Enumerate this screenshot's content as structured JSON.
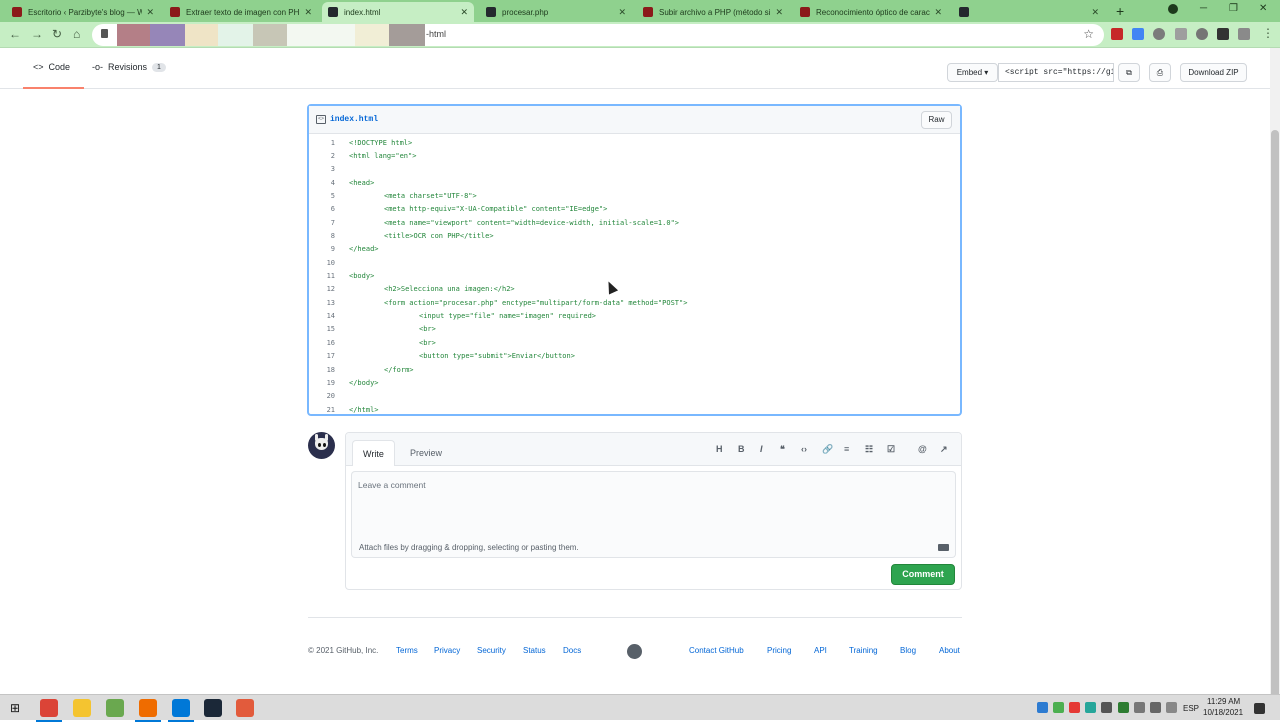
{
  "browser": {
    "tabs": [
      {
        "title": "Escritorio ‹ Parzibyte's blog — W",
        "icon_color": "#8b1a1a"
      },
      {
        "title": "Extraer texto de imagen con PHP",
        "icon_color": "#8b1a1a"
      },
      {
        "title": "index.html",
        "icon_color": "#24292e"
      },
      {
        "title": "procesar.php",
        "icon_color": "#24292e"
      },
      {
        "title": "Subir archivo a PHP (método sin",
        "icon_color": "#8b1a1a"
      },
      {
        "title": "Reconocimiento óptico de carac",
        "icon_color": "#8b1a1a"
      },
      {
        "title": "",
        "icon_color": "#24292e"
      }
    ],
    "new_tab": "+",
    "url_suffix": "-html"
  },
  "gist_nav": {
    "code_label": "Code",
    "revisions_label": "Revisions",
    "revisions_count": "1",
    "embed_label": "Embed",
    "embed_value": "<script src=\"https://gis",
    "download_label": "Download ZIP"
  },
  "file": {
    "name": "index.html",
    "raw_label": "Raw",
    "lines": [
      {
        "n": "1",
        "text": "<!DOCTYPE html>",
        "indent": 0
      },
      {
        "n": "2",
        "text": "<html lang=\"en\">",
        "indent": 0
      },
      {
        "n": "3",
        "text": "",
        "indent": 0
      },
      {
        "n": "4",
        "text": "<head>",
        "indent": 0
      },
      {
        "n": "5",
        "text": "<meta charset=\"UTF-8\">",
        "indent": 1
      },
      {
        "n": "6",
        "text": "<meta http-equiv=\"X-UA-Compatible\" content=\"IE=edge\">",
        "indent": 1
      },
      {
        "n": "7",
        "text": "<meta name=\"viewport\" content=\"width=device-width, initial-scale=1.0\">",
        "indent": 1
      },
      {
        "n": "8",
        "text": "<title>OCR con PHP</title>",
        "indent": 1
      },
      {
        "n": "9",
        "text": "</head>",
        "indent": 0
      },
      {
        "n": "10",
        "text": "",
        "indent": 0
      },
      {
        "n": "11",
        "text": "<body>",
        "indent": 0
      },
      {
        "n": "12",
        "text": "<h2>Selecciona una imagen:</h2>",
        "indent": 1
      },
      {
        "n": "13",
        "text": "<form action=\"procesar.php\" enctype=\"multipart/form-data\" method=\"POST\">",
        "indent": 1
      },
      {
        "n": "14",
        "text": "<input type=\"file\" name=\"imagen\" required>",
        "indent": 2
      },
      {
        "n": "15",
        "text": "<br>",
        "indent": 2
      },
      {
        "n": "16",
        "text": "<br>",
        "indent": 2
      },
      {
        "n": "17",
        "text": "<button type=\"submit\">Enviar</button>",
        "indent": 2
      },
      {
        "n": "18",
        "text": "</form>",
        "indent": 1
      },
      {
        "n": "19",
        "text": "</body>",
        "indent": 0
      },
      {
        "n": "20",
        "text": "",
        "indent": 0
      },
      {
        "n": "21",
        "text": "</html>",
        "indent": 0
      }
    ]
  },
  "comment": {
    "write_label": "Write",
    "preview_label": "Preview",
    "toolbar": [
      "H",
      "B",
      "I",
      "❝",
      "‹›",
      "🔗",
      "≡",
      "☷",
      "☑",
      "@",
      "↗"
    ],
    "placeholder": "Leave a comment",
    "attach_hint": "Attach files by dragging & dropping, selecting or pasting them.",
    "submit_label": "Comment"
  },
  "footer": {
    "copyright": "© 2021 GitHub, Inc.",
    "left_links": [
      "Terms",
      "Privacy",
      "Security",
      "Status",
      "Docs"
    ],
    "right_links": [
      "Contact GitHub",
      "Pricing",
      "API",
      "Training",
      "Blog",
      "About"
    ]
  },
  "taskbar": {
    "apps": [
      {
        "name": "chrome",
        "color": "#db4437"
      },
      {
        "name": "file-explorer",
        "color": "#f4c430"
      },
      {
        "name": "notepad-plus",
        "color": "#6aa84f"
      },
      {
        "name": "postman",
        "color": "#ef6c00"
      },
      {
        "name": "vscode",
        "color": "#0078d7"
      },
      {
        "name": "steam",
        "color": "#1b2838"
      },
      {
        "name": "app-c",
        "color": "#e25b3c"
      }
    ],
    "language": "ESP",
    "time": "11:29 AM",
    "date": "10/18/2021"
  },
  "colors": {
    "accent_green": "#2ea44f",
    "link_blue": "#0366d6",
    "tab_bar": "#8fd18e",
    "code_tag": "#22863a"
  }
}
